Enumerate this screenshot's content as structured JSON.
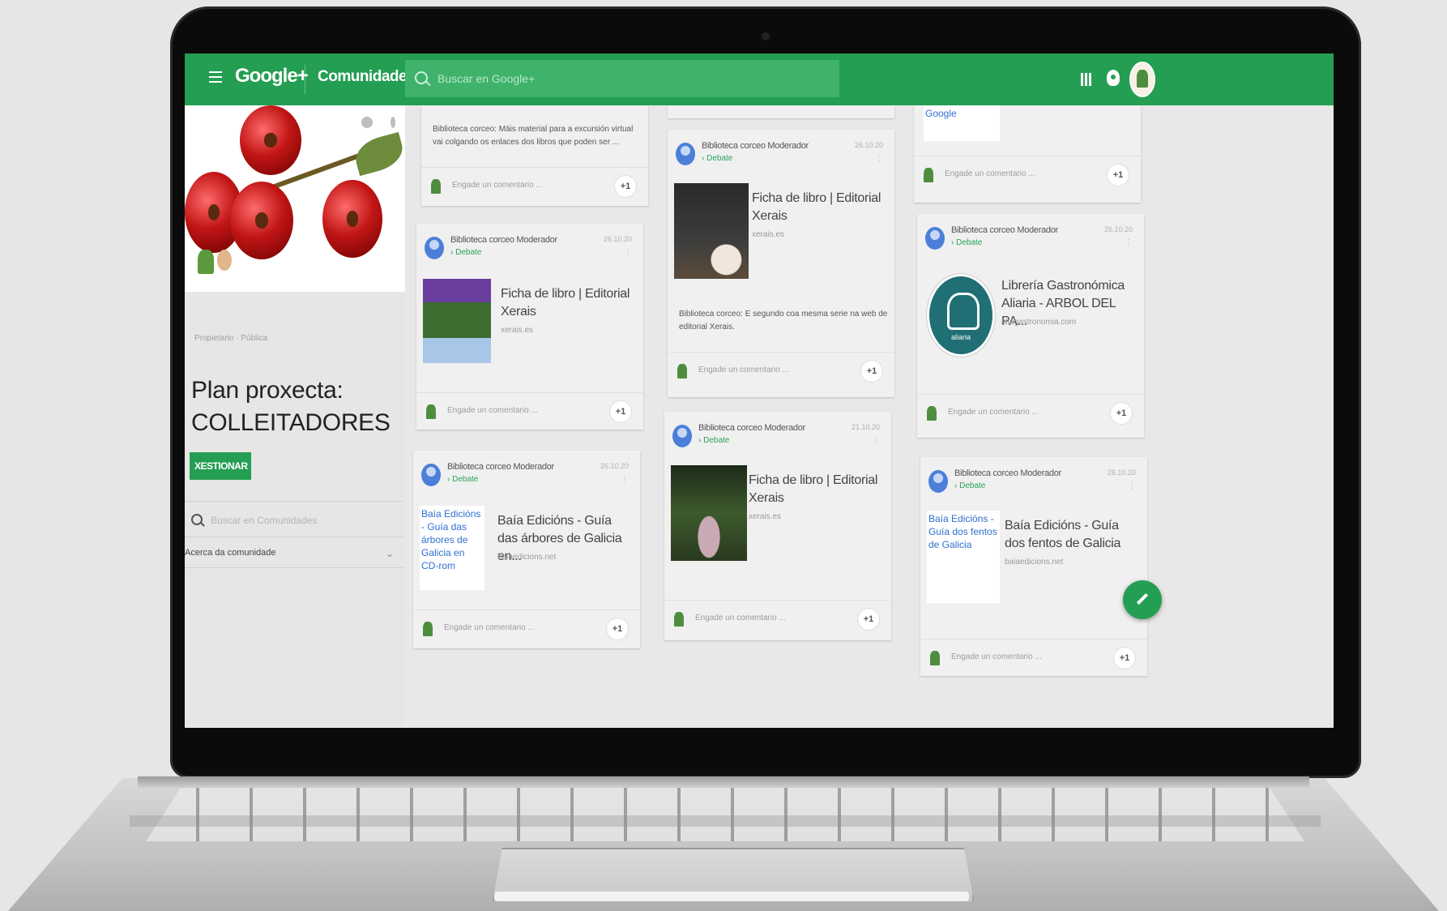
{
  "header": {
    "logo": "Google+",
    "section": "Comunidades",
    "search_placeholder": "Buscar en Google+"
  },
  "sidebar": {
    "privacy": "Propietario · Pública",
    "community_title": "Plan proxecta:\nCOLLEITADORES",
    "manage_button": "XESTIONAR",
    "search_placeholder": "Buscar en Comunidades",
    "about": "Acerca da comunidade"
  },
  "posts": {
    "c1_top": {
      "text": "Biblioteca corceo: Máis material para a excursión virtual vai colgando os enlaces dos libros que poden ser ...",
      "comment": "Engade un comentario ...",
      "plusone": "+1"
    },
    "c1_p2": {
      "author": "Biblioteca corceo  Moderador",
      "category": "› Debate",
      "date": "26.10.20",
      "more": "⋮",
      "title": "Ficha de libro | Editorial Xerais",
      "url": "xerais.es",
      "comment": "Engade un comentario ...",
      "plusone": "+1"
    },
    "c1_p3": {
      "author": "Biblioteca corceo  Moderador",
      "category": "› Debate",
      "date": "26.10.20",
      "more": "⋮",
      "thumb_alt": "Baía Edicións - Guía das árbores de Galicia en CD-rom",
      "title": "Baía Edicións - Guía das árbores de Galicia en...",
      "url": "baiaedicions.net",
      "comment": "Engade un comentario ...",
      "plusone": "+1"
    },
    "c2_p1": {
      "author": "Biblioteca corceo  Moderador",
      "category": "› Debate",
      "date": "26.10.20",
      "more": "⋮",
      "title": "Ficha de libro | Editorial Xerais",
      "url": "xerais.es",
      "text": "Biblioteca corceo: E segundo coa mesma serie na web de editorial Xerais.",
      "comment": "Engade un comentario ...",
      "plusone": "+1"
    },
    "c2_p2": {
      "author": "Biblioteca corceo  Moderador",
      "category": "› Debate",
      "date": "21.10.20",
      "more": "⋮",
      "title": "Ficha de libro | Editorial Xerais",
      "url": "xerais.es",
      "comment": "Engade un comentario ...",
      "plusone": "+1"
    },
    "c3_top": {
      "thumb_alt": "Google",
      "comment": "Engade un comentario ...",
      "plusone": "+1"
    },
    "c3_p2": {
      "author": "Biblioteca corceo  Moderador",
      "category": "› Debate",
      "date": "26.10.20",
      "more": "⋮",
      "title": "Librería Gastronómica Aliaria - ARBOL DEL PA...",
      "url": "aliagastronomia.com",
      "logo_text": "aliaria",
      "comment": "Engade un comentario ...",
      "plusone": "+1"
    },
    "c3_p3": {
      "author": "Biblioteca corceo  Moderador",
      "category": "› Debate",
      "date": "26.10.20",
      "more": "⋮",
      "thumb_alt": "Baía Edicións - Guía dos fentos de Galicia",
      "title": "Baía Edicións - Guía dos fentos de Galicia",
      "url": "baiaedicions.net",
      "comment": "Engade un comentario ...",
      "plusone": "+1"
    }
  },
  "colors": {
    "brand_green": "#249e52",
    "link_blue": "#2f6fd0"
  }
}
